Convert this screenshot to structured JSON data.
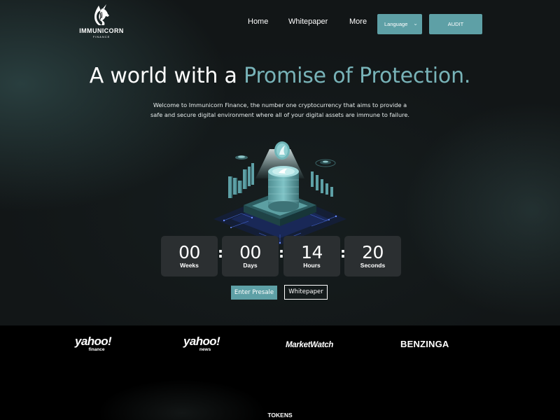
{
  "nav": {
    "brand_name": "IMMUNICORN",
    "brand_sub": "FINANCE",
    "links": [
      "Home",
      "Whitepaper",
      "More"
    ],
    "language_label": "Language",
    "audit_label": "AUDIT"
  },
  "hero": {
    "headline_plain": "A world with a ",
    "headline_accent": "Promise of Protection.",
    "intro_line1": "Welcome to Immunicorn Finance, the number one cryptocurrency that aims to provide a",
    "intro_line2": "safe and secure digital environment where all of your digital assets are immune to failure."
  },
  "countdown": [
    {
      "value": "00",
      "label": "Weeks"
    },
    {
      "value": "00",
      "label": "Days"
    },
    {
      "value": "14",
      "label": "Hours"
    },
    {
      "value": "20",
      "label": "Seconds"
    }
  ],
  "separator": ":",
  "cta": {
    "presale_label": "Enter Presale",
    "whitepaper_label": "Whitepaper"
  },
  "press": {
    "yahoo_finance_main": "yahoo!",
    "yahoo_finance_sub": "finance",
    "yahoo_news_main": "yahoo!",
    "yahoo_news_sub": "news",
    "marketwatch": "MarketWatch",
    "benzinga": "BENZINGA"
  },
  "tokens_label": "TOKENS",
  "colors": {
    "accent": "#5ea0a6",
    "accent_text": "#78b3b8",
    "background": "#121617",
    "countdown_box": "#2b2f31",
    "press_band": "#000000"
  },
  "icons": {
    "logo": "unicorn-head-icon",
    "language_chevron": "chevron-down-icon"
  }
}
